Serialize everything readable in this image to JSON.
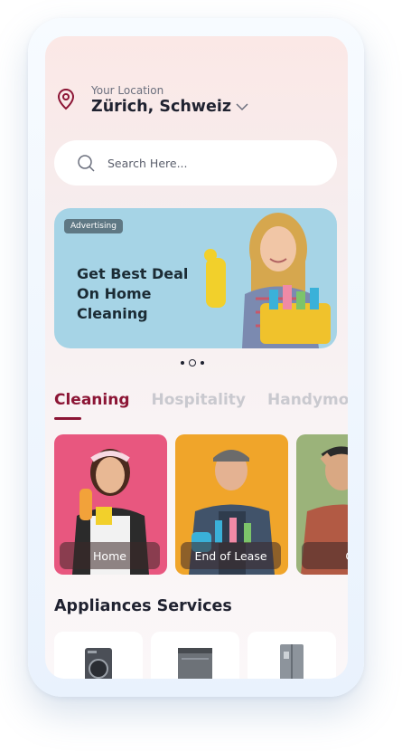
{
  "location": {
    "label": "Your Location",
    "value": "Zürich, Schweiz"
  },
  "search": {
    "placeholder": "Search Here..."
  },
  "banner": {
    "badge": "Advertising",
    "title": "Get Best Deal On Home Cleaning"
  },
  "carousel": {
    "count": 3,
    "active": 1
  },
  "tabs": [
    {
      "label": "Cleaning",
      "active": true
    },
    {
      "label": "Hospitality",
      "active": false
    },
    {
      "label": "Handymo",
      "active": false
    }
  ],
  "services": [
    {
      "label": "Home"
    },
    {
      "label": "End of Lease"
    },
    {
      "label": "Of"
    }
  ],
  "appliances": {
    "title": "Appliances Services",
    "items": [
      {
        "icon": "washing-machine-icon"
      },
      {
        "icon": "dishwasher-icon"
      },
      {
        "icon": "refrigerator-icon"
      }
    ]
  },
  "colors": {
    "accent": "#8c1535",
    "banner_bg": "#a6d4e6",
    "card_pink": "#e8577f",
    "card_orange": "#f0a52a",
    "card_green": "#9bb37a"
  }
}
